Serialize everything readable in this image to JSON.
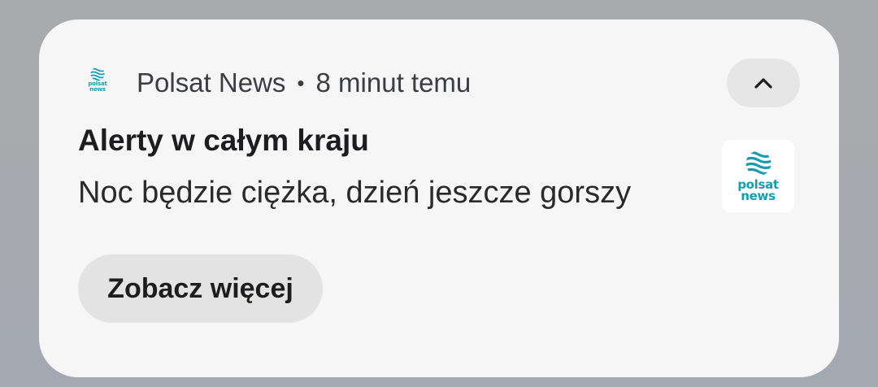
{
  "notification": {
    "app_name": "Polsat News",
    "separator": "•",
    "time": "8 minut temu",
    "title": "Alerty w całym kraju",
    "text": "Noc będzie ciężka, dzień jeszcze gorszy",
    "action_label": "Zobacz więcej",
    "collapse_icon": "chevron-up-icon",
    "logo": {
      "line1": "polsat",
      "line2": "news",
      "color": "#1a9bb0"
    }
  }
}
